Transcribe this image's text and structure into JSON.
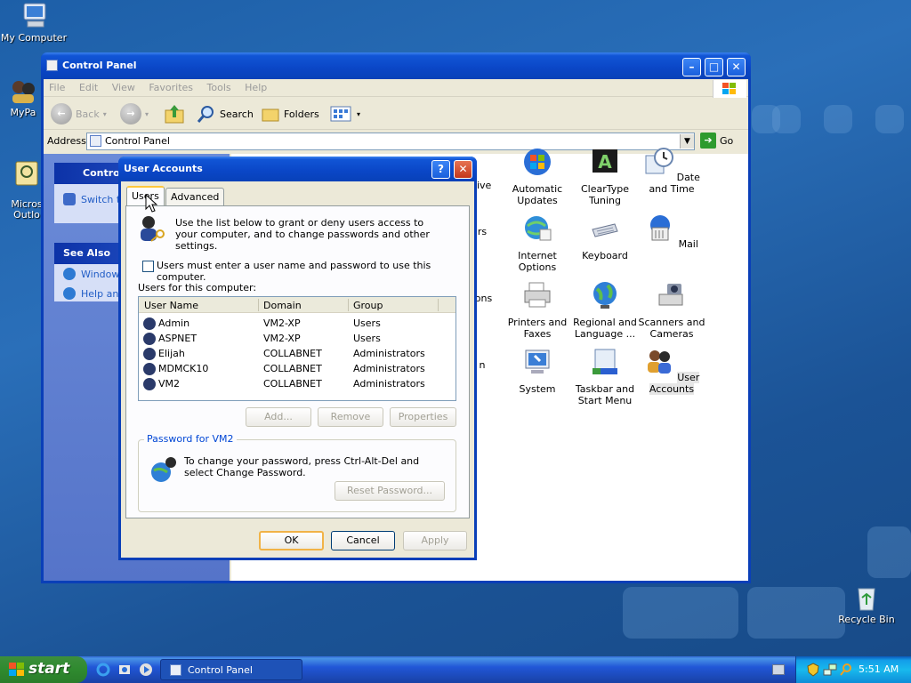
{
  "desktop": {
    "icons": [
      {
        "label": "My Computer"
      },
      {
        "label": "MyPa"
      },
      {
        "label": "Micros\nOutlo"
      },
      {
        "label": "Recycle Bin"
      }
    ]
  },
  "control_panel": {
    "title": "Control Panel",
    "menu": [
      "File",
      "Edit",
      "View",
      "Favorites",
      "Tools",
      "Help"
    ],
    "toolbar": {
      "back": "Back",
      "search": "Search",
      "folders": "Folders"
    },
    "address_label": "Address",
    "address_value": "Control Panel",
    "go_label": "Go",
    "left_pane": {
      "header": "Contro",
      "switch_label": "Switch t",
      "see_also": "See Also",
      "links": [
        "Window",
        "Help an"
      ]
    },
    "icons": [
      {
        "label": "tive"
      },
      {
        "label": "Automatic Updates"
      },
      {
        "label": "ClearType Tuning"
      },
      {
        "label": "Date and Time"
      },
      {
        "label": "rs"
      },
      {
        "label": "Internet Options"
      },
      {
        "label": "Keyboard"
      },
      {
        "label": "Mail"
      },
      {
        "label": "ions"
      },
      {
        "label": "Printers and Faxes"
      },
      {
        "label": "Regional and Language ..."
      },
      {
        "label": "Scanners and Cameras"
      },
      {
        "label": "n"
      },
      {
        "label": "System"
      },
      {
        "label": "Taskbar and Start Menu"
      },
      {
        "label": "User Accounts"
      }
    ]
  },
  "dialog": {
    "title": "User Accounts",
    "tabs": [
      "Users",
      "Advanced"
    ],
    "intro": "Use the list below to grant or deny users access to your computer, and to change passwords and other settings.",
    "checkbox_label": "Users must enter a user name and password to use this computer.",
    "checkbox_checked": false,
    "list_label": "Users for this computer:",
    "columns": [
      "User Name",
      "Domain",
      "Group"
    ],
    "users": [
      {
        "name": "Admin",
        "domain": "VM2-XP",
        "group": "Users"
      },
      {
        "name": "ASPNET",
        "domain": "VM2-XP",
        "group": "Users"
      },
      {
        "name": "Elijah",
        "domain": "COLLABNET",
        "group": "Administrators"
      },
      {
        "name": "MDMCK10",
        "domain": "COLLABNET",
        "group": "Administrators"
      },
      {
        "name": "VM2",
        "domain": "COLLABNET",
        "group": "Administrators"
      }
    ],
    "buttons": {
      "add": "Add...",
      "remove": "Remove",
      "properties": "Properties"
    },
    "password_group": {
      "legend": "Password for VM2",
      "text": "To change your password, press Ctrl-Alt-Del and select Change Password.",
      "reset": "Reset Password..."
    },
    "footer": {
      "ok": "OK",
      "cancel": "Cancel",
      "apply": "Apply"
    }
  },
  "taskbar": {
    "start": "start",
    "task": "Control Panel",
    "clock": "5:51 AM"
  }
}
